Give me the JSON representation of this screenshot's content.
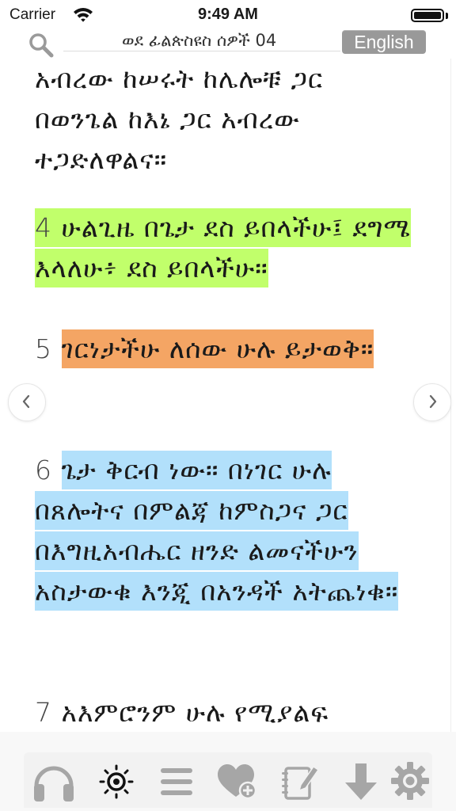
{
  "status_bar": {
    "carrier": "Carrier",
    "time": "9:49 AM",
    "battery_level": 1.0
  },
  "header": {
    "chapter_title": "ወደ ፊልጵስዩስ ሰዎች 04",
    "language_button": "English"
  },
  "reader": {
    "verses": [
      {
        "number": "",
        "text": "አብረው ከሠሩት ከሌሎቹ ጋር በወንጌል ከእኔ ጋር አብረው ተጋድለዋልና።",
        "highlight": null
      },
      {
        "number": "4",
        "text": "ሁልጊዜ በጌታ ደስ ይበላችሁ፤ ደግሜ እላለሁ፥ ደስ ይበላችሁ።",
        "highlight": "#c1ff6b"
      },
      {
        "number": "5",
        "text": "ገርነታችሁ ለሰው ሁሉ ይታወቅ።",
        "highlight": "#f4a564"
      },
      {
        "number": "6",
        "text": "ጌታ ቅርብ ነው። በነገር ሁሉ በጸሎትና በምልጃ ከምስጋና ጋር በእግዚአብሔር ዘንድ ልመናችሁን አስታውቁ እንጂ በአንዳች አትጨነቁ።",
        "highlight": "#b2e0fb"
      },
      {
        "number": "7",
        "text": "አእምሮንም ሁሉ የሚያልፍ",
        "highlight": null
      }
    ]
  },
  "navigation": {
    "previous_icon": "chevron-left-icon",
    "next_icon": "chevron-right-icon"
  },
  "toolbar": {
    "items": [
      {
        "name": "headphones-icon",
        "action": "audio"
      },
      {
        "name": "brightness-icon",
        "action": "brightness"
      },
      {
        "name": "menu-icon",
        "action": "chapter-list"
      },
      {
        "name": "heart-add-icon",
        "action": "favorites"
      },
      {
        "name": "notes-icon",
        "action": "notes"
      },
      {
        "name": "download-icon",
        "action": "download"
      },
      {
        "name": "gear-icon",
        "action": "settings"
      }
    ]
  },
  "colors": {
    "highlight_green": "#c1ff6b",
    "highlight_orange": "#f4a564",
    "highlight_blue": "#b2e0fb",
    "toolbar_icon": "#a6a6a6",
    "language_button_bg": "#999999"
  }
}
